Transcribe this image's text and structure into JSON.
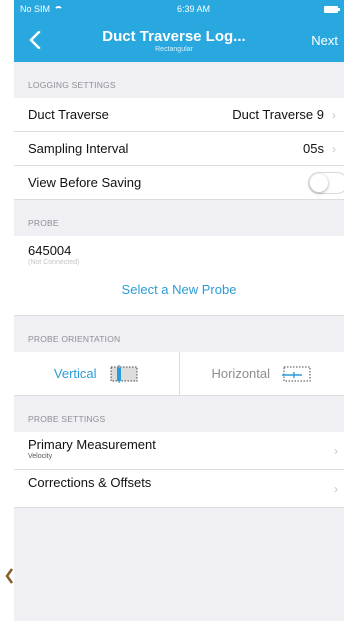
{
  "status_bar": {
    "carrier": "No SIM",
    "time": "6:39 AM"
  },
  "nav": {
    "title": "Duct Traverse Log...",
    "subtitle": "Rectangular",
    "next_label": "Next"
  },
  "logging_settings": {
    "header": "LOGGING SETTINGS",
    "duct_traverse": {
      "label": "Duct Traverse",
      "value": "Duct Traverse 9"
    },
    "sampling_interval": {
      "label": "Sampling Interval",
      "value": "05s"
    },
    "view_before_saving": {
      "label": "View Before Saving",
      "enabled": false
    }
  },
  "probe": {
    "header": "PROBE",
    "serial": "645004",
    "status": "(Not Connected)",
    "select_label": "Select a New Probe"
  },
  "probe_orientation": {
    "header": "PROBE ORIENTATION",
    "vertical_label": "Vertical",
    "horizontal_label": "Horizontal",
    "selected": "Vertical"
  },
  "probe_settings": {
    "header": "PROBE SETTINGS",
    "primary_measurement": {
      "label": "Primary Measurement",
      "value": "Velocity"
    },
    "corrections": {
      "label": "Corrections & Offsets"
    }
  },
  "colors": {
    "accent": "#29a8e0",
    "link": "#2b9cd8"
  }
}
